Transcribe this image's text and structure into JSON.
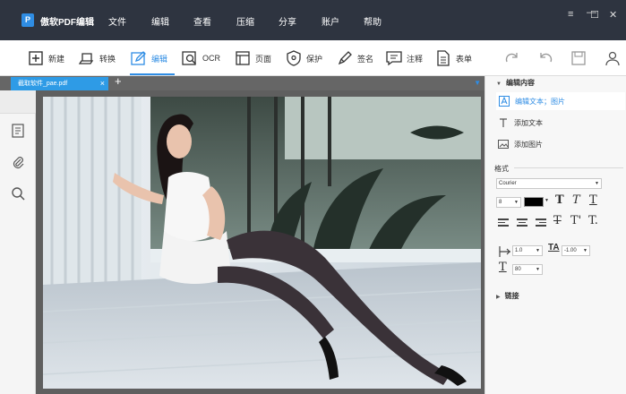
{
  "app": {
    "name": "傲软PDF编辑",
    "logo_letter": "P",
    "accent": "#2f8de4",
    "titlebar_bg": "#2e3440"
  },
  "menu": [
    "文件",
    "编辑",
    "查看",
    "压缩",
    "分享",
    "账户",
    "帮助"
  ],
  "window_controls": [
    "≡",
    "—",
    "☐",
    "✕"
  ],
  "toolbar": [
    {
      "icon": "new-icon",
      "label": "新建"
    },
    {
      "icon": "convert-icon",
      "label": "转换"
    },
    {
      "icon": "edit-icon",
      "label": "编辑",
      "active": true
    },
    {
      "icon": "ocr-icon",
      "label": "OCR"
    },
    {
      "icon": "page-icon",
      "label": "页面"
    },
    {
      "icon": "protect-icon",
      "label": "保护"
    },
    {
      "icon": "sign-icon",
      "label": "签名"
    },
    {
      "icon": "annotate-icon",
      "label": "注释"
    },
    {
      "icon": "form-icon",
      "label": "表单"
    }
  ],
  "toolbar_right": [
    "redo-icon",
    "undo-icon",
    "save-icon",
    "user-icon"
  ],
  "tabs": {
    "active": "截取软件_pae.pdf",
    "close": "×",
    "add": "+",
    "menu": "▼"
  },
  "left_rail": [
    "page-thumbnails-icon",
    "attachment-icon",
    "search-icon"
  ],
  "panel": {
    "edit_section": "编辑内容",
    "options": [
      {
        "icon": "edit-text-image-icon",
        "label": "编辑文本；图片",
        "active": true
      },
      {
        "icon": "add-text-icon",
        "label": "添加文本"
      },
      {
        "icon": "add-image-icon",
        "label": "添加图片"
      }
    ],
    "format_label": "格式",
    "font": "Courier",
    "size": "8",
    "color": "#000000",
    "line_spacing": "1.0",
    "char_spacing": "-1.00",
    "scale": "80",
    "link_section": "链接"
  }
}
